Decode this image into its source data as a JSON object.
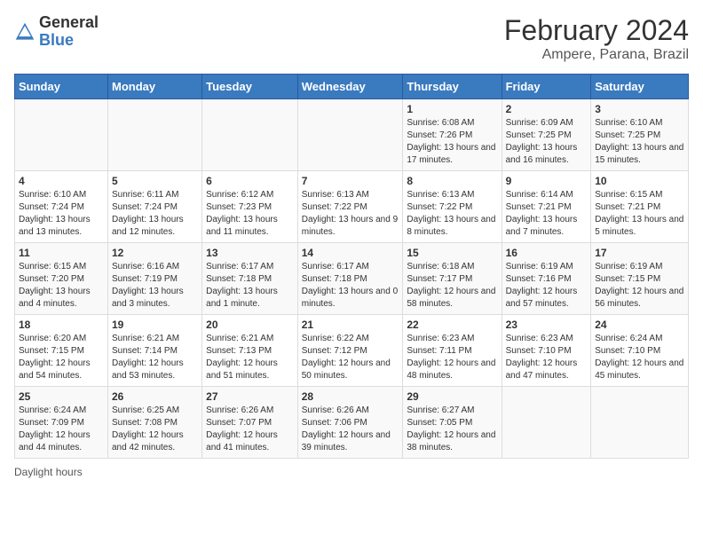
{
  "logo": {
    "general": "General",
    "blue": "Blue"
  },
  "title": "February 2024",
  "subtitle": "Ampere, Parana, Brazil",
  "days_of_week": [
    "Sunday",
    "Monday",
    "Tuesday",
    "Wednesday",
    "Thursday",
    "Friday",
    "Saturday"
  ],
  "footer": "Daylight hours",
  "weeks": [
    [
      {
        "num": "",
        "sunrise": "",
        "sunset": "",
        "daylight": ""
      },
      {
        "num": "",
        "sunrise": "",
        "sunset": "",
        "daylight": ""
      },
      {
        "num": "",
        "sunrise": "",
        "sunset": "",
        "daylight": ""
      },
      {
        "num": "",
        "sunrise": "",
        "sunset": "",
        "daylight": ""
      },
      {
        "num": "1",
        "sunrise": "6:08 AM",
        "sunset": "7:26 PM",
        "daylight": "13 hours and 17 minutes."
      },
      {
        "num": "2",
        "sunrise": "6:09 AM",
        "sunset": "7:25 PM",
        "daylight": "13 hours and 16 minutes."
      },
      {
        "num": "3",
        "sunrise": "6:10 AM",
        "sunset": "7:25 PM",
        "daylight": "13 hours and 15 minutes."
      }
    ],
    [
      {
        "num": "4",
        "sunrise": "6:10 AM",
        "sunset": "7:24 PM",
        "daylight": "13 hours and 13 minutes."
      },
      {
        "num": "5",
        "sunrise": "6:11 AM",
        "sunset": "7:24 PM",
        "daylight": "13 hours and 12 minutes."
      },
      {
        "num": "6",
        "sunrise": "6:12 AM",
        "sunset": "7:23 PM",
        "daylight": "13 hours and 11 minutes."
      },
      {
        "num": "7",
        "sunrise": "6:13 AM",
        "sunset": "7:22 PM",
        "daylight": "13 hours and 9 minutes."
      },
      {
        "num": "8",
        "sunrise": "6:13 AM",
        "sunset": "7:22 PM",
        "daylight": "13 hours and 8 minutes."
      },
      {
        "num": "9",
        "sunrise": "6:14 AM",
        "sunset": "7:21 PM",
        "daylight": "13 hours and 7 minutes."
      },
      {
        "num": "10",
        "sunrise": "6:15 AM",
        "sunset": "7:21 PM",
        "daylight": "13 hours and 5 minutes."
      }
    ],
    [
      {
        "num": "11",
        "sunrise": "6:15 AM",
        "sunset": "7:20 PM",
        "daylight": "13 hours and 4 minutes."
      },
      {
        "num": "12",
        "sunrise": "6:16 AM",
        "sunset": "7:19 PM",
        "daylight": "13 hours and 3 minutes."
      },
      {
        "num": "13",
        "sunrise": "6:17 AM",
        "sunset": "7:18 PM",
        "daylight": "13 hours and 1 minute."
      },
      {
        "num": "14",
        "sunrise": "6:17 AM",
        "sunset": "7:18 PM",
        "daylight": "13 hours and 0 minutes."
      },
      {
        "num": "15",
        "sunrise": "6:18 AM",
        "sunset": "7:17 PM",
        "daylight": "12 hours and 58 minutes."
      },
      {
        "num": "16",
        "sunrise": "6:19 AM",
        "sunset": "7:16 PM",
        "daylight": "12 hours and 57 minutes."
      },
      {
        "num": "17",
        "sunrise": "6:19 AM",
        "sunset": "7:15 PM",
        "daylight": "12 hours and 56 minutes."
      }
    ],
    [
      {
        "num": "18",
        "sunrise": "6:20 AM",
        "sunset": "7:15 PM",
        "daylight": "12 hours and 54 minutes."
      },
      {
        "num": "19",
        "sunrise": "6:21 AM",
        "sunset": "7:14 PM",
        "daylight": "12 hours and 53 minutes."
      },
      {
        "num": "20",
        "sunrise": "6:21 AM",
        "sunset": "7:13 PM",
        "daylight": "12 hours and 51 minutes."
      },
      {
        "num": "21",
        "sunrise": "6:22 AM",
        "sunset": "7:12 PM",
        "daylight": "12 hours and 50 minutes."
      },
      {
        "num": "22",
        "sunrise": "6:23 AM",
        "sunset": "7:11 PM",
        "daylight": "12 hours and 48 minutes."
      },
      {
        "num": "23",
        "sunrise": "6:23 AM",
        "sunset": "7:10 PM",
        "daylight": "12 hours and 47 minutes."
      },
      {
        "num": "24",
        "sunrise": "6:24 AM",
        "sunset": "7:10 PM",
        "daylight": "12 hours and 45 minutes."
      }
    ],
    [
      {
        "num": "25",
        "sunrise": "6:24 AM",
        "sunset": "7:09 PM",
        "daylight": "12 hours and 44 minutes."
      },
      {
        "num": "26",
        "sunrise": "6:25 AM",
        "sunset": "7:08 PM",
        "daylight": "12 hours and 42 minutes."
      },
      {
        "num": "27",
        "sunrise": "6:26 AM",
        "sunset": "7:07 PM",
        "daylight": "12 hours and 41 minutes."
      },
      {
        "num": "28",
        "sunrise": "6:26 AM",
        "sunset": "7:06 PM",
        "daylight": "12 hours and 39 minutes."
      },
      {
        "num": "29",
        "sunrise": "6:27 AM",
        "sunset": "7:05 PM",
        "daylight": "12 hours and 38 minutes."
      },
      {
        "num": "",
        "sunrise": "",
        "sunset": "",
        "daylight": ""
      },
      {
        "num": "",
        "sunrise": "",
        "sunset": "",
        "daylight": ""
      }
    ]
  ]
}
